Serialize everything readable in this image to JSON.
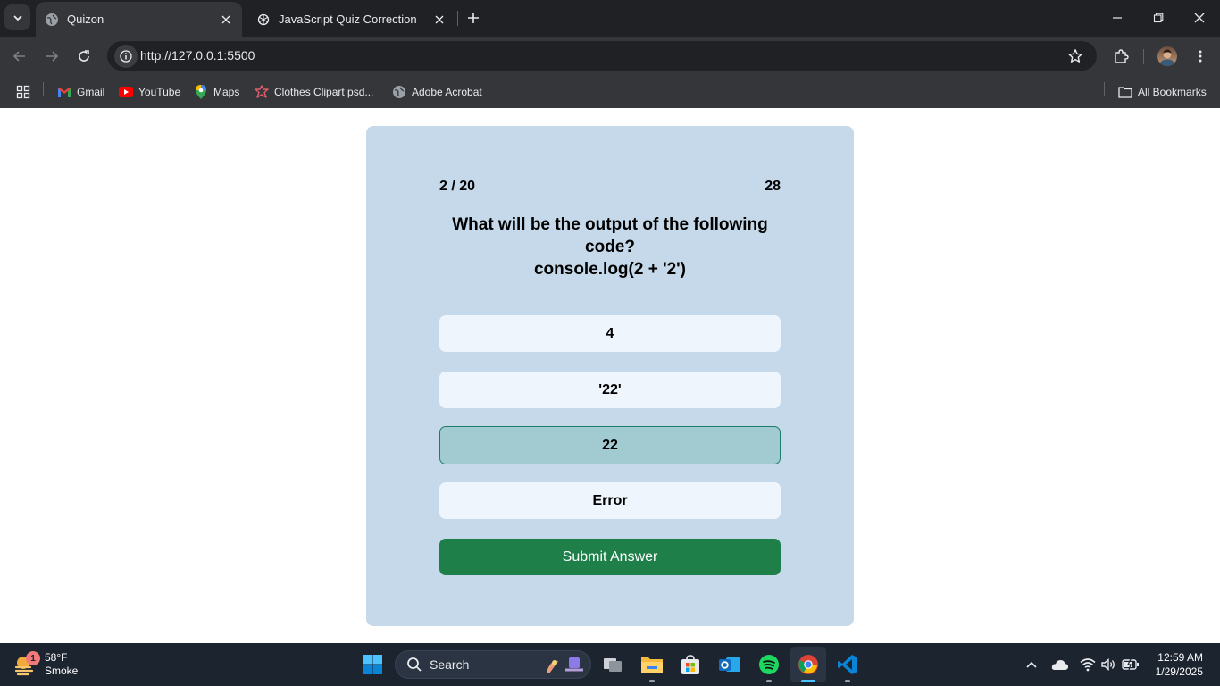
{
  "browser": {
    "tabs": [
      {
        "title": "Quizon",
        "active": true
      },
      {
        "title": "JavaScript Quiz Correction",
        "active": false
      }
    ],
    "url": "http://127.0.0.1:5500",
    "bookmarks": [
      {
        "label": "Gmail",
        "icon": "gmail-icon"
      },
      {
        "label": "YouTube",
        "icon": "youtube-icon"
      },
      {
        "label": "Maps",
        "icon": "maps-icon"
      },
      {
        "label": "Clothes Clipart psd...",
        "icon": "clipart-icon"
      },
      {
        "label": "Adobe Acrobat",
        "icon": "globe-icon"
      }
    ],
    "all_bookmarks_label": "All Bookmarks"
  },
  "quiz": {
    "progress": "2 / 20",
    "timer": "28",
    "question_line1": "What will be the output of the following",
    "question_line2": "code?",
    "question_line3": "console.log(2 + '2')",
    "options": [
      {
        "label": "4",
        "selected": false
      },
      {
        "label": "'22'",
        "selected": false
      },
      {
        "label": "22",
        "selected": true
      },
      {
        "label": "Error",
        "selected": false
      }
    ],
    "submit_label": "Submit Answer"
  },
  "taskbar": {
    "weather": {
      "temp": "58°F",
      "condition": "Smoke",
      "badge": "1"
    },
    "search_placeholder": "Search",
    "time": "12:59 AM",
    "date": "1/29/2025"
  },
  "colors": {
    "card_bg": "#c5d9ea",
    "option_bg": "#eef5fc",
    "selected_bg": "#a2cad1",
    "selected_border": "#1e7d6a",
    "submit_bg": "#1e7f49",
    "browser_dark": "#202124",
    "browser_toolbar": "#35363a",
    "taskbar_bg": "#1c2430"
  }
}
